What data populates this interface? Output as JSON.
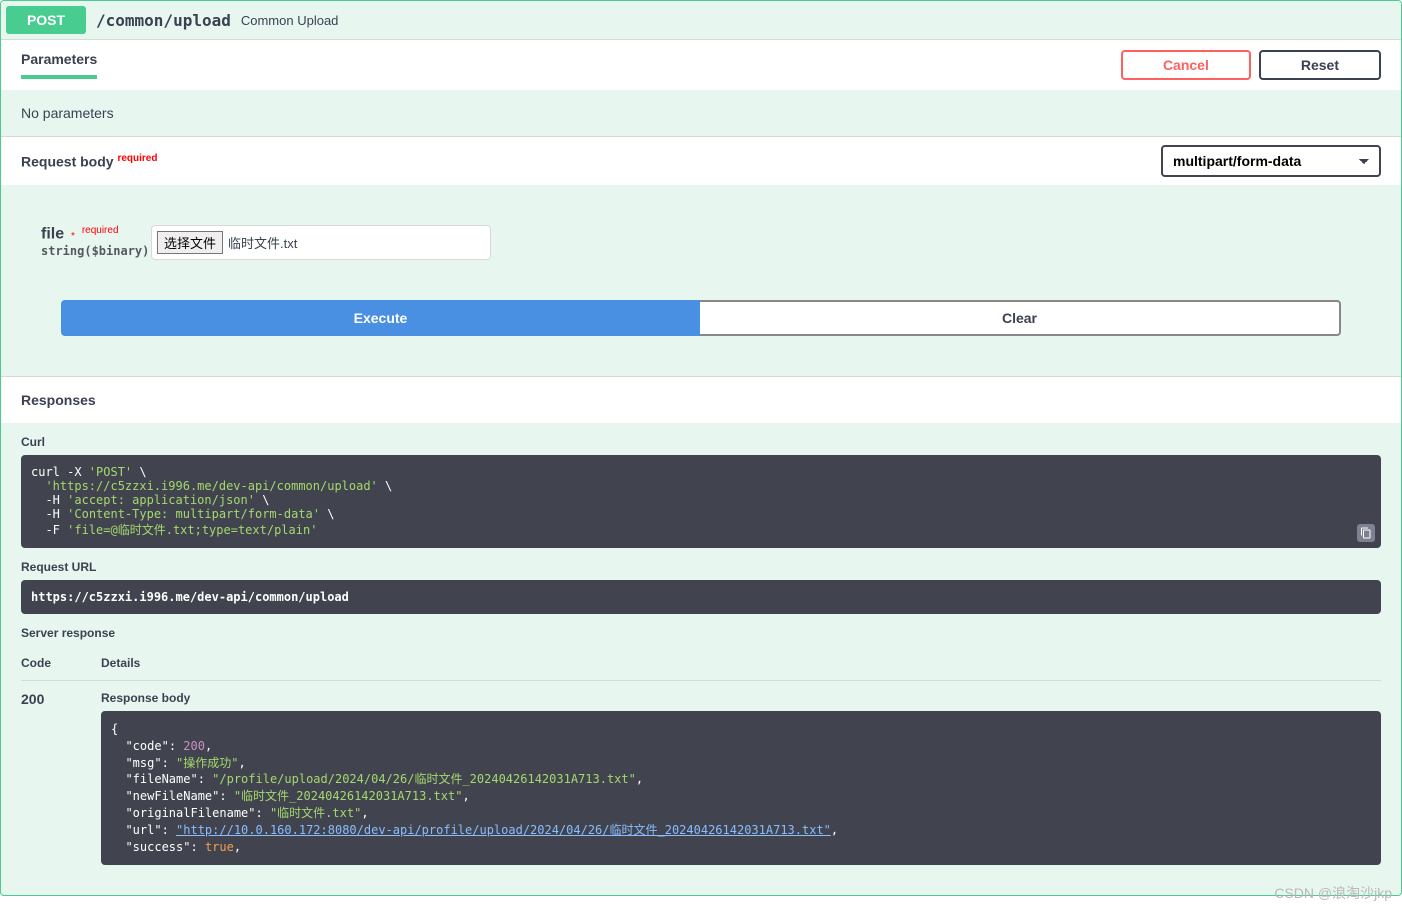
{
  "header": {
    "method": "POST",
    "path": "/common/upload",
    "description": "Common Upload"
  },
  "tabs": {
    "parameters": "Parameters",
    "cancel": "Cancel",
    "reset": "Reset"
  },
  "params": {
    "none": "No parameters"
  },
  "request_body": {
    "title": "Request body",
    "required_label": "required",
    "content_type": "multipart/form-data",
    "param_name": "file",
    "param_star": "*",
    "param_required": "required",
    "param_type": "string($binary)",
    "file_button": "选择文件",
    "file_name": "临时文件.txt"
  },
  "actions": {
    "execute": "Execute",
    "clear": "Clear"
  },
  "responses": {
    "title": "Responses",
    "curl_label": "Curl",
    "curl_cmd": "curl -X ",
    "curl_method": "'POST'",
    "curl_url": "'https://c5zzxi.i996.me/dev-api/common/upload'",
    "curl_h1a": "-H ",
    "curl_h1b": "'accept: application/json'",
    "curl_h2a": "-H ",
    "curl_h2b": "'Content-Type: multipart/form-data'",
    "curl_f1a": "-F ",
    "curl_f1b": "'file=@临时文件.txt;type=text/plain'",
    "request_url_label": "Request URL",
    "request_url": "https://c5zzxi.i996.me/dev-api/common/upload",
    "server_response_label": "Server response",
    "col_code": "Code",
    "col_details": "Details",
    "code": "200",
    "response_body_label": "Response body",
    "body": {
      "code_key": "\"code\"",
      "code_val": "200",
      "msg_key": "\"msg\"",
      "msg_val": "\"操作成功\"",
      "fileName_key": "\"fileName\"",
      "fileName_val": "\"/profile/upload/2024/04/26/临时文件_20240426142031A713.txt\"",
      "newFileName_key": "\"newFileName\"",
      "newFileName_val": "\"临时文件_20240426142031A713.txt\"",
      "originalFilename_key": "\"originalFilename\"",
      "originalFilename_val": "\"临时文件.txt\"",
      "url_key": "\"url\"",
      "url_val": "\"http://10.0.160.172:8080/dev-api/profile/upload/2024/04/26/临时文件_20240426142031A713.txt\"",
      "success_key": "\"success\"",
      "success_val": "true"
    }
  },
  "watermark": "CSDN @浪淘沙jkp"
}
